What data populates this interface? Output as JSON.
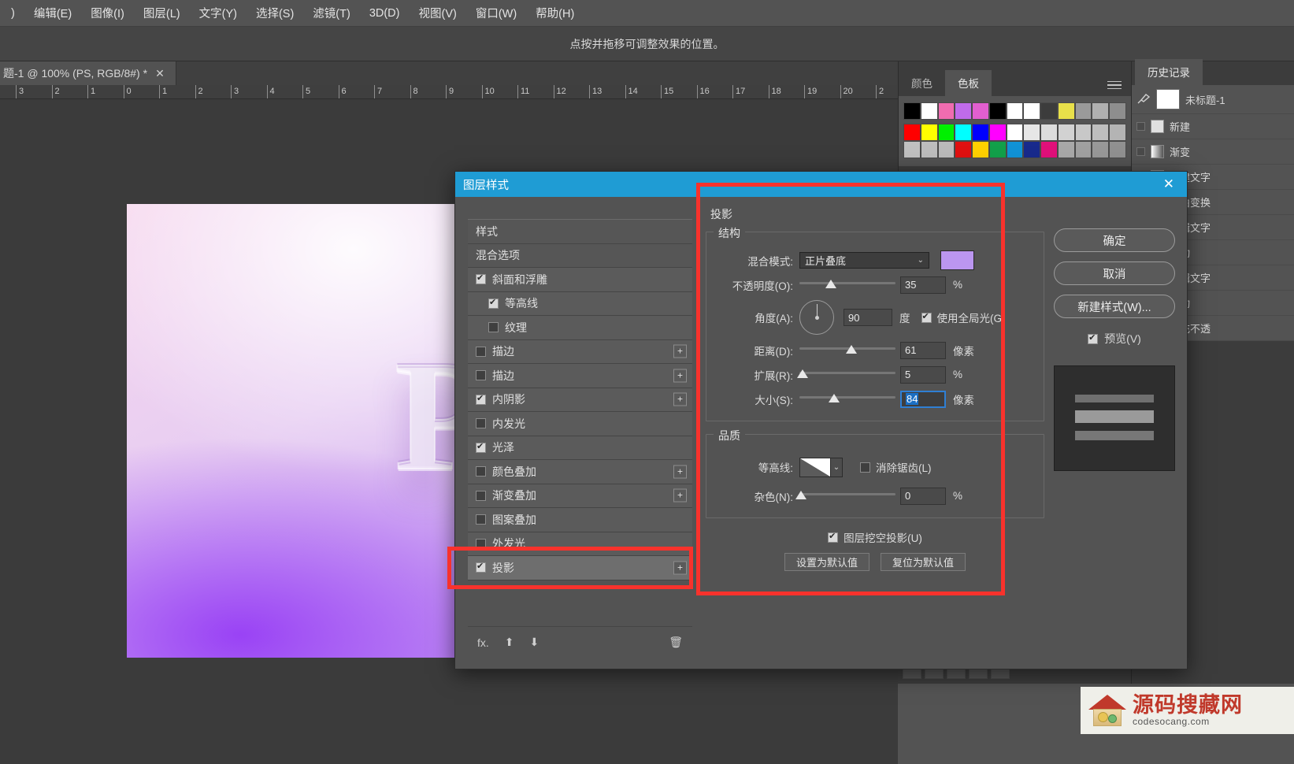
{
  "menubar": {
    "items": [
      {
        "label": ")"
      },
      {
        "label": "编辑(E)"
      },
      {
        "label": "图像(I)"
      },
      {
        "label": "图层(L)"
      },
      {
        "label": "文字(Y)"
      },
      {
        "label": "选择(S)"
      },
      {
        "label": "滤镜(T)"
      },
      {
        "label": "3D(D)"
      },
      {
        "label": "视图(V)"
      },
      {
        "label": "窗口(W)"
      },
      {
        "label": "帮助(H)"
      }
    ]
  },
  "options_bar": {
    "hint": "点按并拖移可调整效果的位置。"
  },
  "document_tab": {
    "title": "题-1 @ 100% (PS, RGB/8#) *",
    "close": "✕"
  },
  "ruler": {
    "labels": [
      "3",
      "2",
      "1",
      "0",
      "1",
      "2",
      "3",
      "4",
      "5",
      "6",
      "7",
      "8",
      "9",
      "10",
      "11",
      "12",
      "13",
      "14",
      "15",
      "16",
      "17",
      "18",
      "19",
      "20",
      "2"
    ]
  },
  "canvas": {
    "artwork_text": "Ps"
  },
  "panels": {
    "colors_dock": {
      "tabs": [
        {
          "label": "颜色",
          "active": false
        },
        {
          "label": "色板",
          "active": true
        }
      ],
      "menu_icon": "hamburger-icon",
      "expand_icon": "double-chevron-icon",
      "swatch_rows": [
        [
          "#000000",
          "#ffffff",
          "#f06cb0",
          "#c06bea",
          "#e25fd0",
          "#000000",
          "#ffffff",
          "#ffffff",
          "#3c3c3c",
          "#e8e04a",
          "#9a9a9a",
          "#b0b0b0",
          "#8e8e8e"
        ],
        [
          "#ff0000",
          "#ffff00",
          "#00f000",
          "#00ffff",
          "#0000ff",
          "#ff00ff",
          "#ffffff",
          "#e6e6e6",
          "#dcdcdc",
          "#d2d2d2",
          "#c8c8c8",
          "#bebebe",
          "#b4b4b4"
        ],
        [
          "#c0c0c0",
          "#bdbdbd",
          "#bababa",
          "#e01010",
          "#ffd000",
          "#12a04a",
          "#1192d6",
          "#182a8c",
          "#e0107a",
          "#a8a8a8",
          "#a0a0a0",
          "#989898",
          "#909090"
        ]
      ]
    },
    "history_dock": {
      "tab": "历史记录",
      "snapshot_label": "未标题-1",
      "brush_icon": "history-brush-icon",
      "items": [
        {
          "label": "新建",
          "icon": "new-doc-icon"
        },
        {
          "label": "渐变",
          "icon": "gradient-icon"
        },
        {
          "label": "新建文字",
          "icon": "text-icon"
        },
        {
          "label": "自由变换",
          "icon": "transform-icon"
        },
        {
          "label": "编辑文字",
          "icon": "text-icon"
        },
        {
          "label": "移动",
          "icon": "move-icon"
        },
        {
          "label": "编辑文字",
          "icon": "text-icon"
        },
        {
          "label": "移动",
          "icon": "move-icon"
        },
        {
          "label": "填充不透",
          "icon": "opacity-icon"
        }
      ]
    }
  },
  "dialog": {
    "title": "图层样式",
    "close": "✕",
    "styles_list": [
      {
        "label": "样式",
        "type": "plain",
        "checkbox": null,
        "indent": false,
        "plus": false,
        "selected": false
      },
      {
        "label": "混合选项",
        "type": "plain",
        "checkbox": null,
        "indent": false,
        "plus": false,
        "selected": false
      },
      {
        "label": "斜面和浮雕",
        "type": "item",
        "checkbox": true,
        "indent": false,
        "plus": false,
        "selected": false
      },
      {
        "label": "等高线",
        "type": "item",
        "checkbox": true,
        "indent": true,
        "plus": false,
        "selected": false
      },
      {
        "label": "纹理",
        "type": "item",
        "checkbox": false,
        "indent": true,
        "plus": false,
        "selected": false
      },
      {
        "label": "描边",
        "type": "item",
        "checkbox": false,
        "indent": false,
        "plus": true,
        "selected": false
      },
      {
        "label": "描边",
        "type": "item",
        "checkbox": false,
        "indent": false,
        "plus": true,
        "selected": false
      },
      {
        "label": "内阴影",
        "type": "item",
        "checkbox": true,
        "indent": false,
        "plus": true,
        "selected": false
      },
      {
        "label": "内发光",
        "type": "item",
        "checkbox": false,
        "indent": false,
        "plus": false,
        "selected": false
      },
      {
        "label": "光泽",
        "type": "item",
        "checkbox": true,
        "indent": false,
        "plus": false,
        "selected": false
      },
      {
        "label": "颜色叠加",
        "type": "item",
        "checkbox": false,
        "indent": false,
        "plus": true,
        "selected": false
      },
      {
        "label": "渐变叠加",
        "type": "item",
        "checkbox": false,
        "indent": false,
        "plus": true,
        "selected": false
      },
      {
        "label": "图案叠加",
        "type": "item",
        "checkbox": false,
        "indent": false,
        "plus": false,
        "selected": false
      },
      {
        "label": "外发光",
        "type": "item",
        "checkbox": false,
        "indent": false,
        "plus": false,
        "selected": false
      },
      {
        "label": "投影",
        "type": "item",
        "checkbox": true,
        "indent": false,
        "plus": true,
        "selected": true
      }
    ],
    "styles_footer": {
      "fx": "fx.",
      "up": "⬆",
      "down": "⬇",
      "trash": "🗑"
    },
    "settings": {
      "group_title": "投影",
      "structure": {
        "legend": "结构",
        "blend_mode": {
          "label": "混合模式:",
          "value": "正片叠底",
          "chevron": "⌄",
          "color": "#bb96f0"
        },
        "opacity": {
          "label": "不透明度(O):",
          "value": "35",
          "unit": "%",
          "knob_pct": 33
        },
        "angle": {
          "label": "角度(A):",
          "value": "90",
          "unit": "度",
          "dial_deg": 90,
          "global_light": {
            "label": "使用全局光(G)",
            "checked": true
          }
        },
        "distance": {
          "label": "距离(D):",
          "value": "61",
          "unit": "像素",
          "knob_pct": 54
        },
        "spread": {
          "label": "扩展(R):",
          "value": "5",
          "unit": "%",
          "knob_pct": 4
        },
        "size": {
          "label": "大小(S):",
          "value": "84",
          "unit": "像素",
          "knob_pct": 36,
          "focused": true
        }
      },
      "quality": {
        "legend": "品质",
        "contour": {
          "label": "等高线:",
          "chevron": "⌄"
        },
        "anti_alias": {
          "label": "消除锯齿(L)",
          "checked": false
        },
        "noise": {
          "label": "杂色(N):",
          "value": "0",
          "unit": "%",
          "knob_pct": 0
        }
      },
      "knockout": {
        "label": "图层挖空投影(U)",
        "checked": true
      },
      "set_default_button": "设置为默认值",
      "reset_default_button": "复位为默认值"
    },
    "buttons": {
      "ok": "确定",
      "cancel": "取消",
      "new_style": "新建样式(W)...",
      "preview": {
        "label": "预览(V)",
        "checked": true
      }
    }
  },
  "annotations": {
    "accent_color": "#f8322c",
    "rect_1": "投影 row highlight",
    "rect_2": "投影 settings highlight"
  },
  "watermark": {
    "title": "源码搜藏网",
    "subtitle": "codesocang.com"
  }
}
